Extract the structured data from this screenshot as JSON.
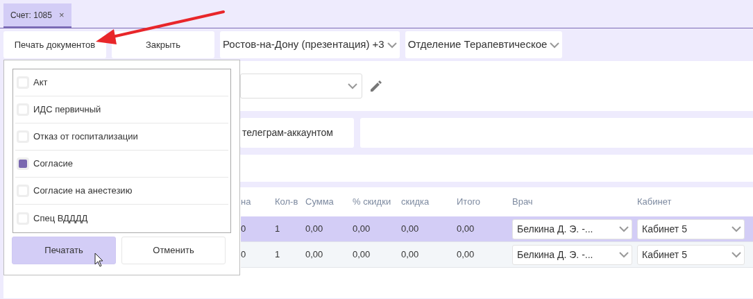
{
  "tabs": [
    {
      "label": "Счет: 1085",
      "close": "×",
      "selected": true
    }
  ],
  "toolbar": {
    "buttons": [
      "Печать документов",
      "Закрыть"
    ],
    "selects": [
      {
        "value": "Ростов-на-Дону (презентация) +3"
      },
      {
        "value": "Отделение Терапевтическое"
      }
    ]
  },
  "contact": {
    "button": "телеграм-аккаунтом"
  },
  "table": {
    "columns": [
      "на",
      "Кол-в",
      "Сумма",
      "% скидки",
      "скидка",
      "Итого",
      "Врач",
      "Кабинет"
    ],
    "rows": [
      {
        "selected": true,
        "cells": [
          "0",
          "1",
          "0,00",
          "0,00",
          "0,00",
          "0,00"
        ],
        "doctor": "Белкина Д. Э. -...",
        "cabinet": "Кабинет 5"
      },
      {
        "selected": false,
        "cells": [
          "0",
          "1",
          "0,00",
          "0,00",
          "0,00",
          "0,00"
        ],
        "doctor": "Белкина Д. Э. -...",
        "cabinet": "Кабинет 5"
      }
    ]
  },
  "print_popup": {
    "documents": [
      {
        "label": "Акт",
        "checked": false
      },
      {
        "label": "ИДС первичный",
        "checked": false
      },
      {
        "label": "Отказ от госпитализации",
        "checked": false
      },
      {
        "label": "Согласие",
        "checked": true
      },
      {
        "label": "Согласие на анестезию",
        "checked": false
      },
      {
        "label": "Спец ВДДДД",
        "checked": false
      }
    ],
    "buttons": [
      {
        "label": "Печатать",
        "kind": "primary"
      },
      {
        "label": "Отменить",
        "kind": "secondary"
      }
    ]
  }
}
